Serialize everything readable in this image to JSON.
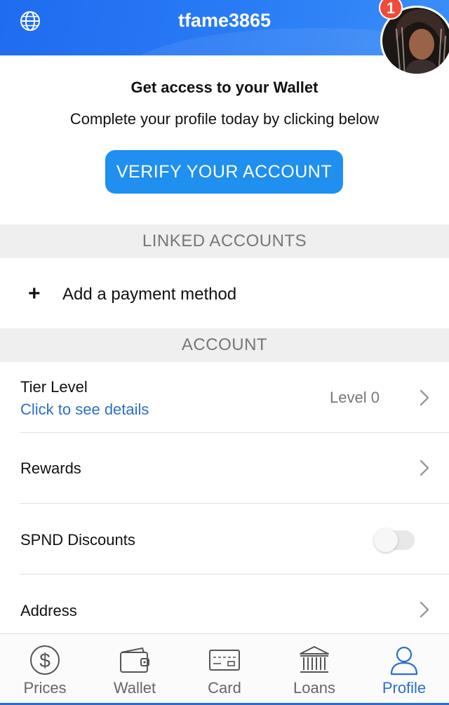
{
  "header": {
    "username": "tfame3865",
    "notification_count": "1",
    "accent": "#1f6cf0"
  },
  "verify": {
    "title": "Get access to your Wallet",
    "subtitle": "Complete your profile today by clicking below",
    "button_label": "VERIFY YOUR ACCOUNT"
  },
  "linked_accounts": {
    "header": "LINKED ACCOUNTS",
    "add_payment_label": "Add a payment method"
  },
  "account": {
    "header": "ACCOUNT",
    "tier": {
      "title": "Tier Level",
      "link": "Click to see details",
      "value": "Level 0"
    },
    "rewards": {
      "title": "Rewards"
    },
    "spnd": {
      "title": "SPND Discounts",
      "enabled": false
    },
    "address": {
      "title": "Address"
    }
  },
  "tabs": [
    {
      "label": "Prices",
      "icon": "dollar-icon",
      "active": false
    },
    {
      "label": "Wallet",
      "icon": "wallet-icon",
      "active": false
    },
    {
      "label": "Card",
      "icon": "card-icon",
      "active": false
    },
    {
      "label": "Loans",
      "icon": "bank-icon",
      "active": false
    },
    {
      "label": "Profile",
      "icon": "person-icon",
      "active": true
    }
  ]
}
